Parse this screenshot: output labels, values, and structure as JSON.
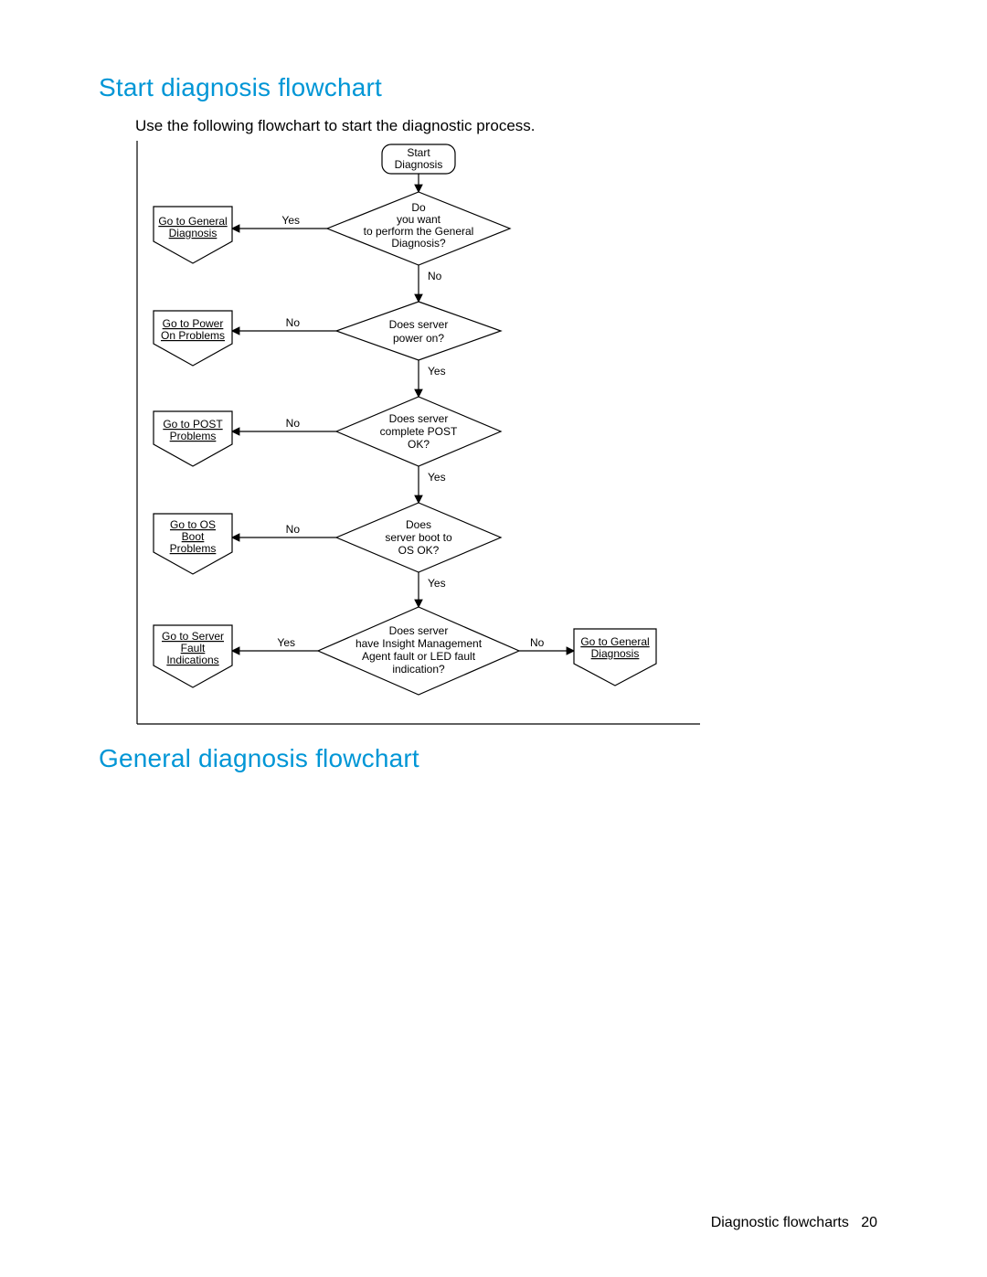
{
  "headings": {
    "h1": "Start diagnosis flowchart",
    "h2": "General diagnosis flowchart"
  },
  "intro": "Use the following flowchart to start the diagnostic process.",
  "footer": {
    "section": "Diagnostic flowcharts",
    "page": "20"
  },
  "flow": {
    "start": {
      "l1": "Start",
      "l2": "Diagnosis"
    },
    "d1": {
      "l1": "Do",
      "l2": "you want",
      "l3": "to perform the General",
      "l4": "Diagnosis?"
    },
    "d2": {
      "l1": "Does server",
      "l2": "power on?"
    },
    "d3": {
      "l1": "Does server",
      "l2": "complete POST",
      "l3": "OK?"
    },
    "d4": {
      "l1": "Does",
      "l2": "server boot to",
      "l3": "OS OK?"
    },
    "d5": {
      "l1": "Does server",
      "l2": "have Insight Management",
      "l3": "Agent fault or LED fault",
      "l4": "indication?"
    },
    "dest1": {
      "l1": "Go to General",
      "l2": "Diagnosis"
    },
    "dest2": {
      "l1": "Go to Power",
      "l2": "On Problems"
    },
    "dest3": {
      "l1": "Go to POST",
      "l2": "Problems"
    },
    "dest4": {
      "l1": "Go to OS",
      "l2": "Boot",
      "l3": "Problems"
    },
    "dest5": {
      "l1": "Go to Server",
      "l2": "Fault",
      "l3": "Indications"
    },
    "dest6": {
      "l1": "Go to General",
      "l2": "Diagnosis"
    },
    "labels": {
      "yes": "Yes",
      "no": "No"
    }
  }
}
